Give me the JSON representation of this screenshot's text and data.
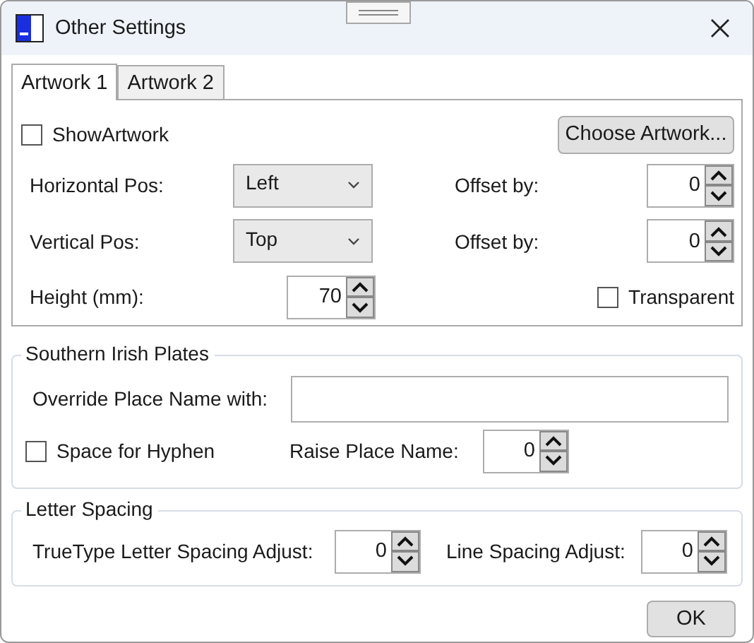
{
  "window": {
    "title": "Other Settings"
  },
  "tabs": [
    {
      "label": "Artwork 1",
      "selected": true
    },
    {
      "label": "Artwork 2",
      "selected": false
    }
  ],
  "artwork": {
    "show_artwork": {
      "label": "ShowArtwork",
      "checked": false
    },
    "choose_button": "Choose Artwork...",
    "horizontal_pos": {
      "label": "Horizontal Pos:",
      "value": "Left"
    },
    "horizontal_offset": {
      "label": "Offset by:",
      "value": "0"
    },
    "vertical_pos": {
      "label": "Vertical Pos:",
      "value": "Top"
    },
    "vertical_offset": {
      "label": "Offset by:",
      "value": "0"
    },
    "height": {
      "label": "Height (mm):",
      "value": "70"
    },
    "transparent": {
      "label": "Transparent",
      "checked": false
    }
  },
  "southern_irish_plates": {
    "title": "Southern Irish Plates",
    "override_place_name": {
      "label": "Override Place Name with:"
    },
    "space_for_hyphen": {
      "label": "Space for Hyphen",
      "checked": false
    },
    "raise_place_name": {
      "label": "Raise Place Name:",
      "value": "0"
    }
  },
  "letter_spacing": {
    "title": "Letter Spacing",
    "truetype_adjust": {
      "label": "TrueType Letter Spacing Adjust:",
      "value": "0"
    },
    "line_adjust": {
      "label": "Line Spacing Adjust:",
      "value": "0"
    }
  },
  "buttons": [
    "OK"
  ]
}
